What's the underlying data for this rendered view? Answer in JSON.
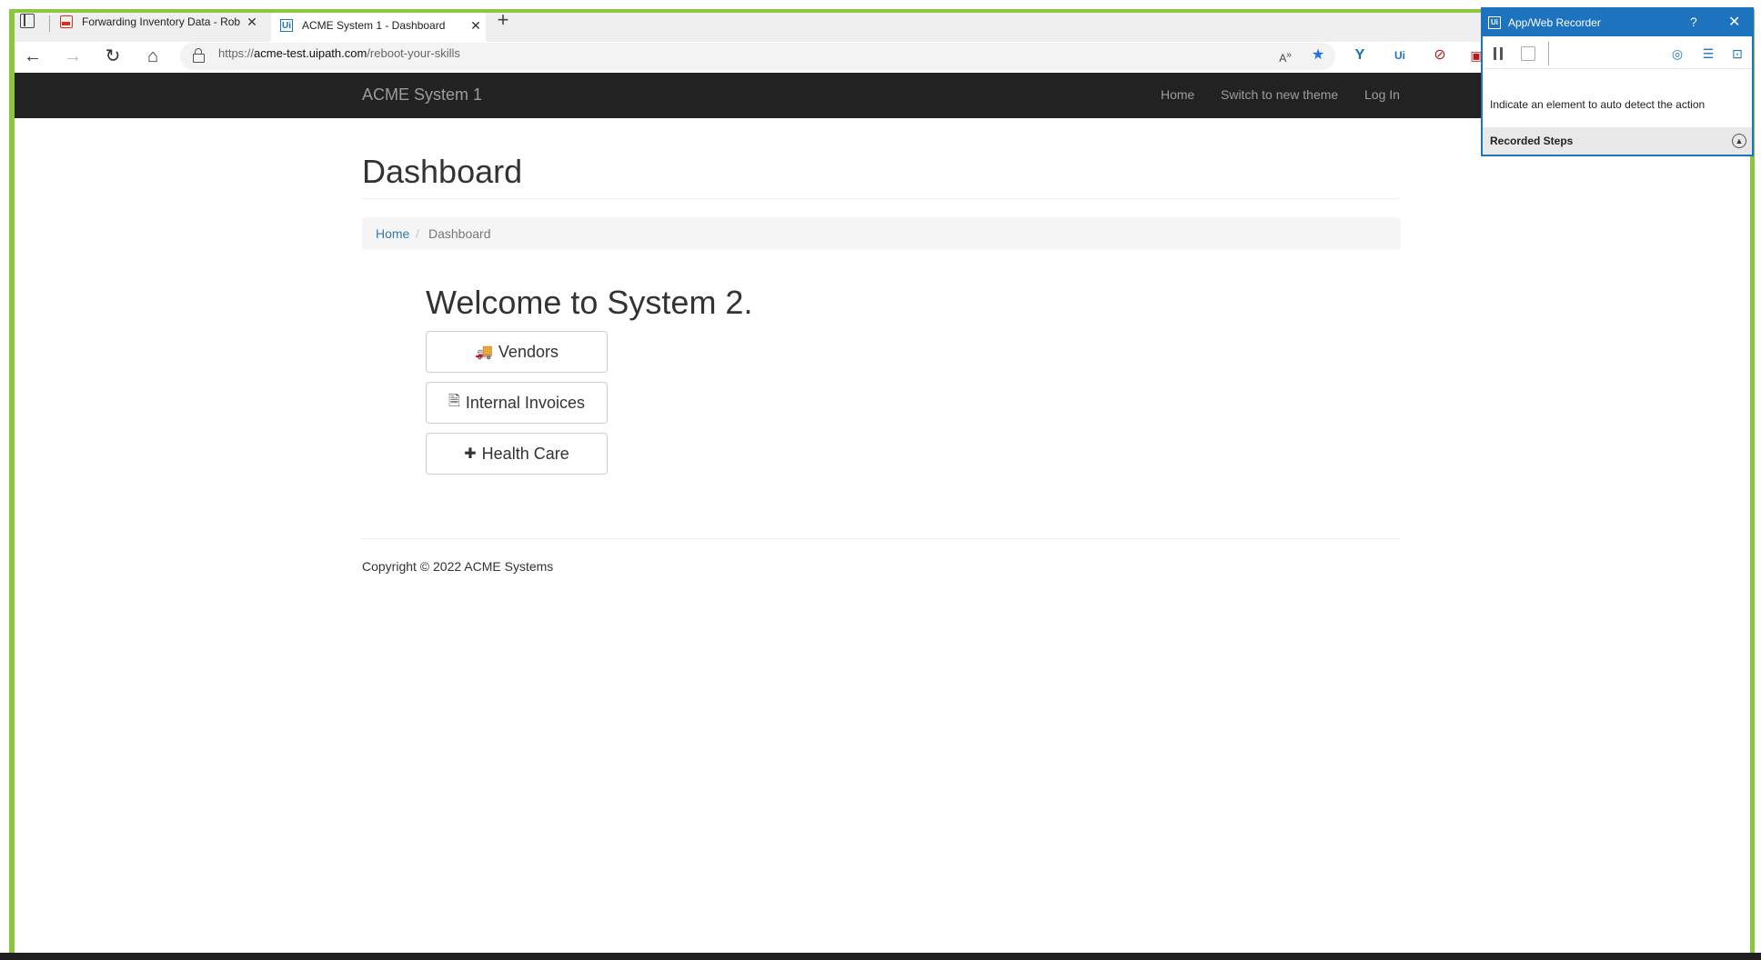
{
  "browser": {
    "tabs": [
      {
        "title": "Forwarding Inventory Data - Rob",
        "favicon": "pdf-icon",
        "active": false
      },
      {
        "title": "ACME System 1 - Dashboard",
        "favicon": "uipath-icon",
        "active": true
      }
    ],
    "address": {
      "prefix": "https://",
      "host": "acme-test.uipath.com",
      "path": "/reboot-your-skills"
    }
  },
  "site": {
    "brand": "ACME System 1",
    "nav": [
      {
        "label": "Home"
      },
      {
        "label": "Switch to new theme"
      },
      {
        "label": "Log In"
      }
    ]
  },
  "main": {
    "title": "Dashboard",
    "breadcrumb": {
      "home": "Home",
      "separator": "/",
      "current": "Dashboard"
    },
    "welcome": "Welcome to System 2.",
    "buttons": [
      {
        "label": "Vendors",
        "icon": "truck-icon"
      },
      {
        "label": "Internal Invoices",
        "icon": "invoice-icon"
      },
      {
        "label": "Health Care",
        "icon": "medkit-icon"
      }
    ],
    "footer": "Copyright © 2022 ACME Systems"
  },
  "recorder": {
    "title": "App/Web Recorder",
    "help": "?",
    "message": "Indicate an element to auto detect the action",
    "steps_label": "Recorded Steps"
  },
  "colors": {
    "frame": "#8cc63e",
    "navbar": "#222222",
    "link": "#337ab7",
    "recorder_accent": "#1e73be"
  }
}
